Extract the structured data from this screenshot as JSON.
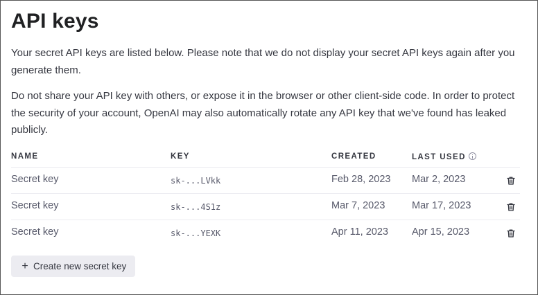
{
  "page": {
    "title": "API keys",
    "paragraph_1": "Your secret API keys are listed below. Please note that we do not display your secret API keys again after you generate them.",
    "paragraph_2": "Do not share your API key with others, or expose it in the browser or other client-side code. In order to protect the security of your account, OpenAI may also automatically rotate any API key that we've found has leaked publicly."
  },
  "table": {
    "columns": {
      "name": "NAME",
      "key": "KEY",
      "created": "CREATED",
      "last_used": "LAST USED"
    },
    "rows": [
      {
        "name": "Secret key",
        "key": "sk-...LVkk",
        "created": "Feb 28, 2023",
        "last_used": "Mar 2, 2023"
      },
      {
        "name": "Secret key",
        "key": "sk-...4S1z",
        "created": "Mar 7, 2023",
        "last_used": "Mar 17, 2023"
      },
      {
        "name": "Secret key",
        "key": "sk-...YEXK",
        "created": "Apr 11, 2023",
        "last_used": "Apr 15, 2023"
      }
    ],
    "row_action_icon": "trash-icon",
    "header_info_icon": "info-icon"
  },
  "actions": {
    "create_label": "Create new secret key",
    "create_icon": "plus-icon"
  },
  "colors": {
    "text_primary": "#202123",
    "text_body": "#353740",
    "text_muted": "#565869",
    "row_divider": "#ececf1",
    "button_bg": "#ececf1"
  }
}
